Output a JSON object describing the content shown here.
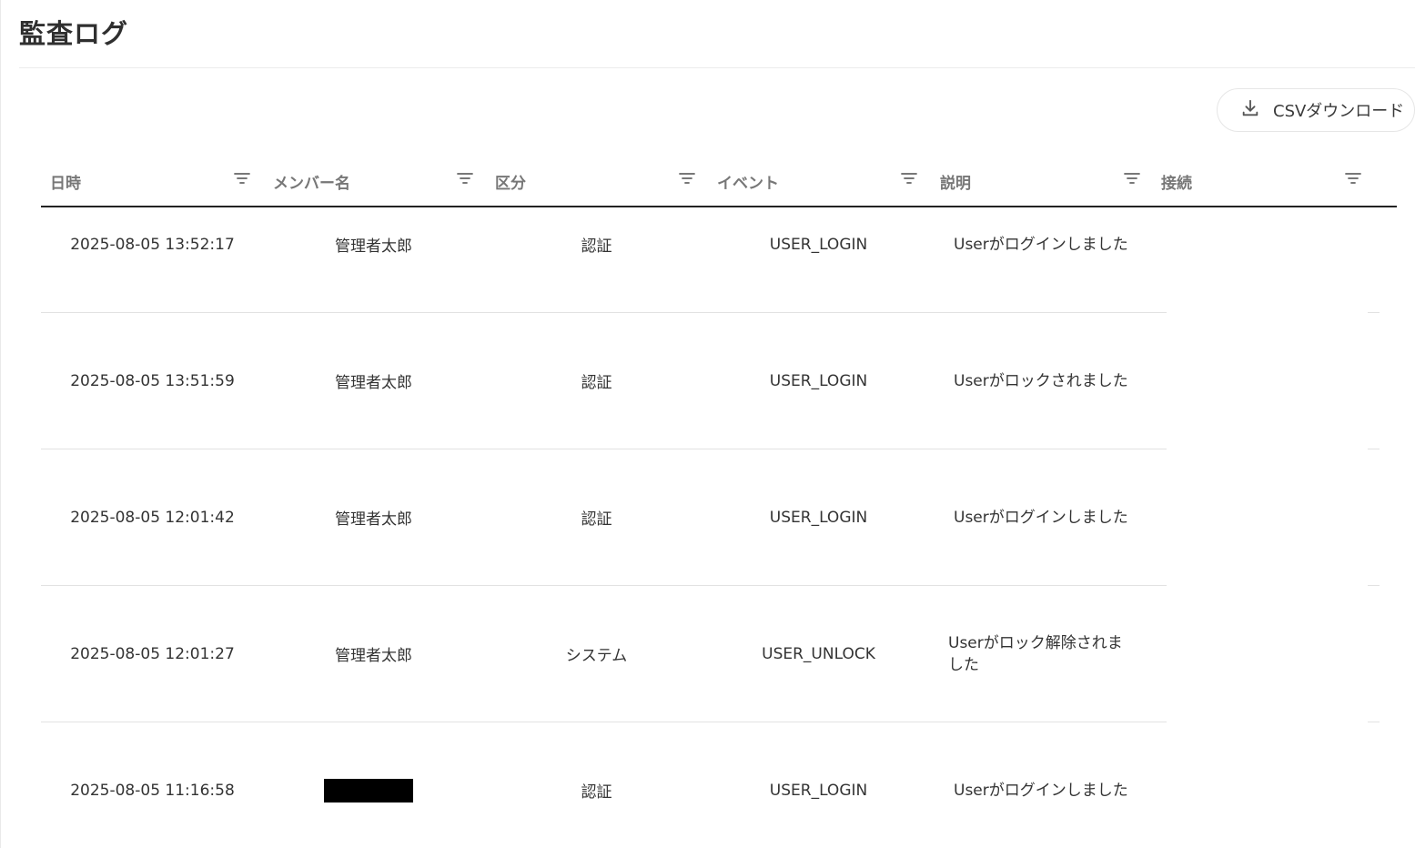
{
  "page": {
    "title": "監査ログ"
  },
  "toolbar": {
    "csv_label": "CSVダウンロード"
  },
  "table": {
    "columns": [
      "日時",
      "メンバー名",
      "区分",
      "イベント",
      "説明",
      "接続"
    ],
    "rows": [
      {
        "datetime": "2025-08-05 13:52:17",
        "member": "管理者太郎",
        "category": "認証",
        "event": "USER_LOGIN",
        "description": "Userがログインしました",
        "connection": ""
      },
      {
        "datetime": "2025-08-05 13:51:59",
        "member": "管理者太郎",
        "category": "認証",
        "event": "USER_LOGIN",
        "description": "Userがロックされました",
        "connection": ""
      },
      {
        "datetime": "2025-08-05 12:01:42",
        "member": "管理者太郎",
        "category": "認証",
        "event": "USER_LOGIN",
        "description": "Userがログインしました",
        "connection": ""
      },
      {
        "datetime": "2025-08-05 12:01:27",
        "member": "管理者太郎",
        "category": "システム",
        "event": "USER_UNLOCK",
        "description": "Userがロック解除されました",
        "connection": ""
      },
      {
        "datetime": "2025-08-05 11:16:58",
        "member": "",
        "category": "認証",
        "event": "USER_LOGIN",
        "description": "Userがログインしました",
        "connection": ""
      }
    ]
  },
  "colors": {
    "header_text": "#777777",
    "header_rule": "#222222",
    "row_divider": "#e2e2e2"
  },
  "icons": {
    "download": "download-icon",
    "filter": "filter-icon"
  }
}
